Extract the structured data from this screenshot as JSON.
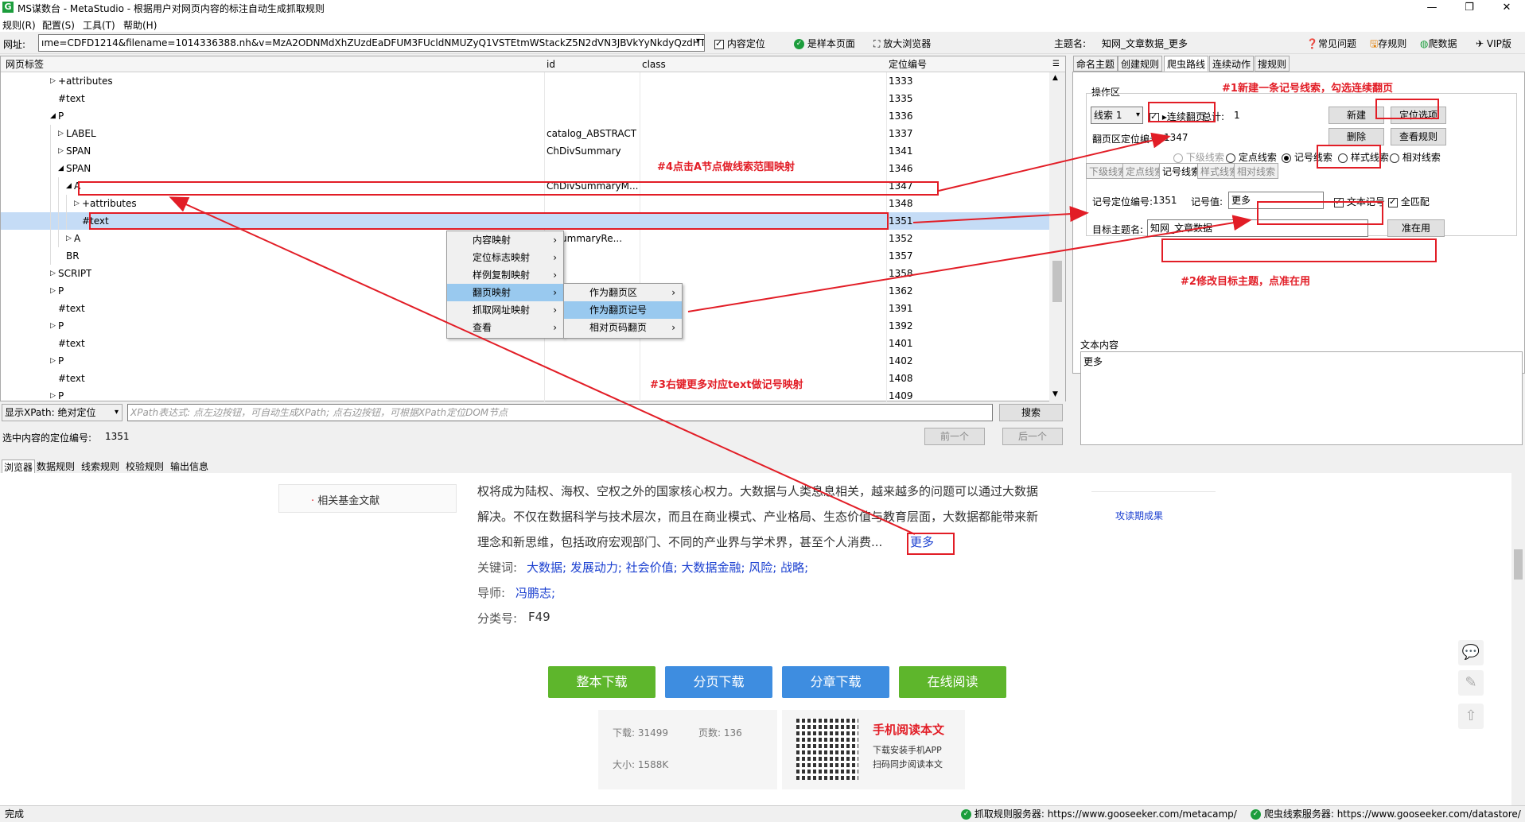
{
  "window": {
    "title": "MS谋数台 - MetaStudio - 根据用户对网页内容的标注自动生成抓取规则",
    "controls": [
      "—",
      "❐",
      "✕"
    ]
  },
  "menubar": {
    "items": [
      "规则(R)",
      "配置(S)",
      "工具(T)",
      "帮助(H)"
    ]
  },
  "address": {
    "label": "网址:",
    "value": "ıme=CDFD1214&filename=1014336388.nh&v=MzA2ODNMdXhZUzdEaDFUM3FUcldNMUZyQ1VSTEtmWStackZ5N2dVN3JBVkYyNkdyQzdHTk",
    "locate": "内容定位",
    "sample": "是样本页面",
    "zoom": "放大浏览器",
    "theme_label": "主题名:",
    "theme_value": "知网_文章数据_更多",
    "faq": "常见问题",
    "save": "存规则",
    "crawl": "爬数据",
    "vip": "VIP版"
  },
  "tree": {
    "headers": [
      "网页标签",
      "id",
      "class",
      "定位编号"
    ],
    "rows": [
      {
        "label": "+attributes",
        "id": "",
        "cls": "",
        "num": "1333",
        "indent": 72,
        "exp": "▷"
      },
      {
        "label": "#text",
        "id": "",
        "cls": "",
        "num": "1335",
        "indent": 72,
        "exp": ""
      },
      {
        "label": "P",
        "id": "",
        "cls": "",
        "num": "1336",
        "indent": 72,
        "exp": "◢"
      },
      {
        "label": "LABEL",
        "id": "",
        "cls": "catalog_ABSTRACT",
        "num": "1337",
        "indent": 82,
        "exp": "▷"
      },
      {
        "label": "SPAN",
        "id": "",
        "cls": "ChDivSummary",
        "num": "1341",
        "indent": 82,
        "exp": "▷"
      },
      {
        "label": "SPAN",
        "id": "",
        "cls": "",
        "num": "1346",
        "indent": 82,
        "exp": "◢"
      },
      {
        "label": "A",
        "id": "",
        "cls": "ChDivSummaryM...",
        "num": "1347",
        "indent": 92,
        "exp": "◢"
      },
      {
        "label": "+attributes",
        "id": "",
        "cls": "",
        "num": "1348",
        "indent": 102,
        "exp": "▷"
      },
      {
        "label": "#text",
        "id": "",
        "cls": "",
        "num": "1351",
        "indent": 102,
        "exp": ""
      },
      {
        "label": "A",
        "id": "",
        "cls": "ivSummaryRe...",
        "num": "1352",
        "indent": 92,
        "exp": "▷"
      },
      {
        "label": "BR",
        "id": "",
        "cls": "",
        "num": "1357",
        "indent": 82,
        "exp": ""
      },
      {
        "label": "SCRIPT",
        "id": "",
        "cls": "",
        "num": "1358",
        "indent": 72,
        "exp": "▷"
      },
      {
        "label": "P",
        "id": "",
        "cls": "",
        "num": "1362",
        "indent": 72,
        "exp": "▷"
      },
      {
        "label": "#text",
        "id": "",
        "cls": "",
        "num": "1391",
        "indent": 72,
        "exp": ""
      },
      {
        "label": "P",
        "id": "",
        "cls": "",
        "num": "1392",
        "indent": 72,
        "exp": "▷"
      },
      {
        "label": "#text",
        "id": "",
        "cls": "",
        "num": "1401",
        "indent": 72,
        "exp": ""
      },
      {
        "label": "P",
        "id": "",
        "cls": "",
        "num": "1402",
        "indent": 72,
        "exp": "▷"
      },
      {
        "label": "#text",
        "id": "",
        "cls": "",
        "num": "1408",
        "indent": 72,
        "exp": ""
      },
      {
        "label": "P",
        "id": "",
        "cls": "",
        "num": "1409",
        "indent": 72,
        "exp": "▷"
      }
    ]
  },
  "context_menu": {
    "items": [
      "内容映射",
      "定位标志映射",
      "样例复制映射",
      "翻页映射",
      "抓取网址映射",
      "查看"
    ],
    "submenu": [
      "作为翻页区",
      "作为翻页记号",
      "相对页码翻页"
    ]
  },
  "annotations": {
    "a1": "#1新建一条记号线索，勾选连续翻页",
    "a2": "#2修改目标主题，点准在用",
    "a3": "#3右键更多对应text做记号映射",
    "a4": "#4点击A节点做线索范围映射"
  },
  "xpath": {
    "mode": "显示XPath: 绝对定位",
    "placeholder": "XPath表达式: 点左边按钮，可自动生成XPath; 点右边按钮，可根据XPath定位DOM节点",
    "search": "搜索",
    "sel_label": "选中内容的定位编号:",
    "sel_value": "1351",
    "prev": "前一个",
    "next": "后一个"
  },
  "right": {
    "tabs": [
      "命名主题",
      "创建规则",
      "爬虫路线",
      "连续动作",
      "搜规则"
    ],
    "ops_label": "操作区",
    "clue": "线索 1",
    "continuous": "连续翻页",
    "total_label": "总计:",
    "total": "1",
    "btn_new": "新建",
    "btn_locate": "定位选项",
    "btn_del": "删除",
    "btn_view": "查看规则",
    "page_label": "翻页区定位编号:",
    "page_value": "1347",
    "radios": [
      "下级线索",
      "定点线索",
      "记号线索",
      "样式线索",
      "相对线索"
    ],
    "subtabs": [
      "下级线索",
      "定点线索",
      "记号线索",
      "样式线索",
      "相对线索"
    ],
    "mark_label": "记号定位编号:",
    "mark_num": "1351",
    "mark_val_label": "记号值:",
    "mark_val": "更多",
    "text_mark": "文本记号",
    "full_match": "全匹配",
    "target_label": "目标主题名:",
    "target_value": "知网_文章数据",
    "btn_apply": "准在用",
    "text_title": "文本内容",
    "text_value": "更多"
  },
  "bottom_tabs": [
    "浏览器",
    "数据规则",
    "线索规则",
    "校验规则",
    "输出信息"
  ],
  "page": {
    "side": "相关基金文献",
    "p1": "权将成为陆权、海权、空权之外的国家核心权力。大数据与人类息息相关，越来越多的问题可以通过大数据",
    "p2": "解决。不仅在数据科学与技术层次，而且在商业模式、产业格局、生态价值与教育层面，大数据都能带来新",
    "p3": "理念和新思维，包括政府宏观部门、不同的产业界与学术界，甚至个人消费...",
    "more": "更多",
    "kw_label": "关键词:",
    "kw": "大数据; 发展动力; 社会价值; 大数据金融; 风险; 战略;",
    "tutor_label": "导师:",
    "tutor": "冯鹏志;",
    "cls_label": "分类号:",
    "cls": "F49",
    "right_link": "攻读期成果",
    "buttons": [
      "整本下载",
      "分页下载",
      "分章下载",
      "在线阅读"
    ],
    "dl_label": "下载:",
    "dl": "31499",
    "pages_label": "页数:",
    "pages": "136",
    "size_label": "大小:",
    "size": "1588K",
    "mobile_title": "手机阅读本文",
    "mobile_1": "下载安装手机APP",
    "mobile_2": "扫码同步阅读本文"
  },
  "status": {
    "left": "完成",
    "server1_label": "抓取规则服务器:",
    "server1": "https://www.gooseeker.com/metacamp/",
    "server2_label": "爬虫线索服务器:",
    "server2": "https://www.gooseeker.com/datastore/"
  },
  "colors": {
    "annotation": "#e21d26",
    "selected_row": "#c5dcf6",
    "btn_green": "#5eb62c",
    "btn_blue": "#3e8de0",
    "link": "#1a3fd0"
  }
}
